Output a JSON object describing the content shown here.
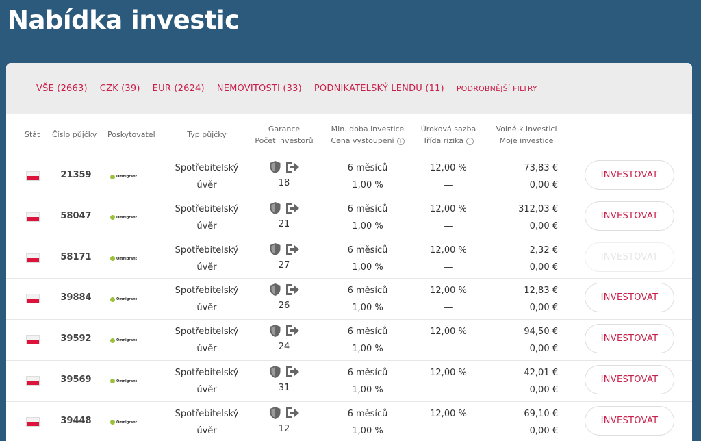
{
  "page_title": "Nabídka investic",
  "filters": [
    {
      "label": "VŠE (2663)"
    },
    {
      "label": "CZK (39)"
    },
    {
      "label": "EUR (2624)"
    },
    {
      "label": "NEMOVITOSTI (33)"
    },
    {
      "label": "PODNIKATELSKÝ LENDU (11)"
    },
    {
      "label": "PODROBNĚJŠÍ FILTRY"
    }
  ],
  "columns": {
    "country": "Stát",
    "loan_number": "Číslo půjčky",
    "provider": "Poskytovatel",
    "loan_type": "Typ půjčky",
    "guarantee_line1": "Garance",
    "guarantee_line2": "Počet investorů",
    "duration_line1": "Min. doba investice",
    "duration_line2": "Cena vystoupení",
    "rate_line1": "Úroková sazba",
    "rate_line2": "Třída rizika",
    "available_line1": "Volné k investici",
    "available_line2": "Moje investice",
    "info_glyph": "i"
  },
  "provider_logo": {
    "name": "Omnigrant"
  },
  "rows": [
    {
      "loan_number": "21359",
      "type_line1": "Spotřebitelský",
      "type_line2": "úvěr",
      "investors": "18",
      "duration": "6 měsíců",
      "exit_price": "1,00 %",
      "rate": "12,00 %",
      "risk": "—",
      "available": "73,83 €",
      "my_investment": "0,00 €",
      "button": "INVESTOVAT",
      "disabled": false
    },
    {
      "loan_number": "58047",
      "type_line1": "Spotřebitelský",
      "type_line2": "úvěr",
      "investors": "21",
      "duration": "6 měsíců",
      "exit_price": "1,00 %",
      "rate": "12,00 %",
      "risk": "—",
      "available": "312,03 €",
      "my_investment": "0,00 €",
      "button": "INVESTOVAT",
      "disabled": false
    },
    {
      "loan_number": "58171",
      "type_line1": "Spotřebitelský",
      "type_line2": "úvěr",
      "investors": "27",
      "duration": "6 měsíců",
      "exit_price": "1,00 %",
      "rate": "12,00 %",
      "risk": "—",
      "available": "2,32 €",
      "my_investment": "0,00 €",
      "button": "INVESTOVAT",
      "disabled": true
    },
    {
      "loan_number": "39884",
      "type_line1": "Spotřebitelský",
      "type_line2": "úvěr",
      "investors": "26",
      "duration": "6 měsíců",
      "exit_price": "1,00 %",
      "rate": "12,00 %",
      "risk": "—",
      "available": "12,83 €",
      "my_investment": "0,00 €",
      "button": "INVESTOVAT",
      "disabled": false
    },
    {
      "loan_number": "39592",
      "type_line1": "Spotřebitelský",
      "type_line2": "úvěr",
      "investors": "24",
      "duration": "6 měsíců",
      "exit_price": "1,00 %",
      "rate": "12,00 %",
      "risk": "—",
      "available": "94,50 €",
      "my_investment": "0,00 €",
      "button": "INVESTOVAT",
      "disabled": false
    },
    {
      "loan_number": "39569",
      "type_line1": "Spotřebitelský",
      "type_line2": "úvěr",
      "investors": "31",
      "duration": "6 měsíců",
      "exit_price": "1,00 %",
      "rate": "12,00 %",
      "risk": "—",
      "available": "42,01 €",
      "my_investment": "0,00 €",
      "button": "INVESTOVAT",
      "disabled": false
    },
    {
      "loan_number": "39448",
      "type_line1": "Spotřebitelský",
      "type_line2": "úvěr",
      "investors": "12",
      "duration": "6 měsíců",
      "exit_price": "1,00 %",
      "rate": "12,00 %",
      "risk": "—",
      "available": "69,10 €",
      "my_investment": "0,00 €",
      "button": "INVESTOVAT",
      "disabled": false
    }
  ],
  "colors": {
    "background": "#2c5a7c",
    "accent": "#c8204a",
    "panel": "#ffffff",
    "filter_bar": "#ececec"
  },
  "icons": {
    "guarantee": "shield-icon",
    "exit": "exit-arrow-icon",
    "flag": "poland-flag-icon"
  }
}
